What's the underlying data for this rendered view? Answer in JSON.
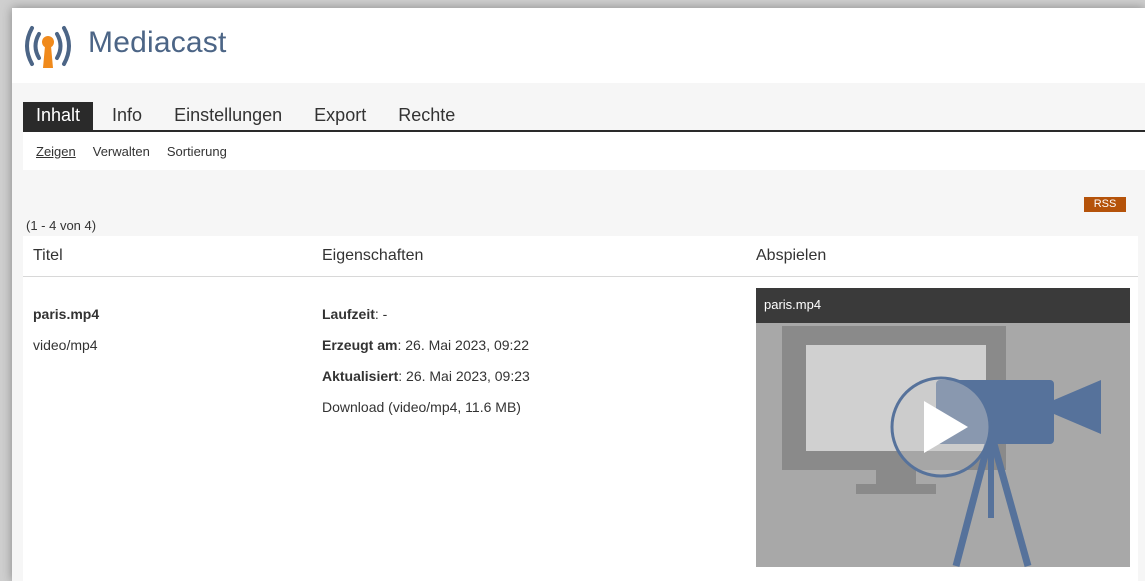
{
  "app": {
    "title": "Mediacast"
  },
  "tabs": [
    {
      "label": "Inhalt",
      "active": true
    },
    {
      "label": "Info",
      "active": false
    },
    {
      "label": "Einstellungen",
      "active": false
    },
    {
      "label": "Export",
      "active": false
    },
    {
      "label": "Rechte",
      "active": false
    }
  ],
  "subtabs": [
    {
      "label": "Zeigen",
      "active": true
    },
    {
      "label": "Verwalten",
      "active": false
    },
    {
      "label": "Sortierung",
      "active": false
    }
  ],
  "rss_label": "RSS",
  "count_text": "(1 - 4 von 4)",
  "table": {
    "headers": [
      "Titel",
      "Eigenschaften",
      "Abspielen"
    ],
    "rows": [
      {
        "title": "paris.mp4",
        "mime": "video/mp4",
        "properties": [
          {
            "label": "Laufzeit",
            "value": ": -"
          },
          {
            "label": "Erzeugt am",
            "value": ": 26. Mai 2023, 09:22"
          },
          {
            "label": "Aktualisiert",
            "value": ": 26. Mai 2023, 09:23"
          }
        ],
        "download": "Download (video/mp4, 11.6 MB)",
        "player_title": "paris.mp4"
      }
    ]
  },
  "colors": {
    "accent": "#4c6586",
    "logo_orange": "#f08a1c",
    "tab_active": "#2a2a2a",
    "rss": "#b5530a"
  },
  "icons": {
    "logo": "broadcast-antenna-icon",
    "player": "play-icon"
  }
}
